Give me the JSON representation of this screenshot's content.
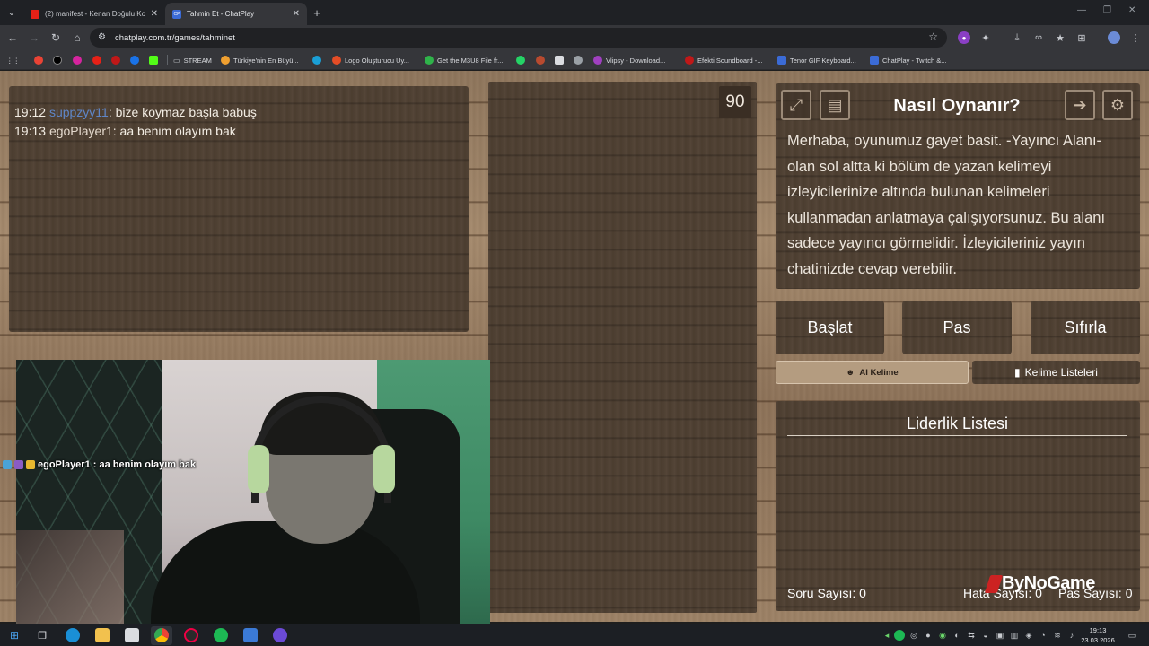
{
  "browser": {
    "tabs": [
      {
        "label": "(2) manifest - Kenan Doğulu Ko",
        "favicon_color": "#e62117"
      },
      {
        "label": "Tahmin Et - ChatPlay",
        "favicon_color": "#3b6bd6",
        "favicon_text": "CP"
      }
    ],
    "url": "chatplay.com.tr/games/tahminet",
    "bookmarks": [
      {
        "label": "STREAM",
        "color": "#c8cbd0"
      },
      {
        "label": "Türkiye'nin En Büyü...",
        "color": "#f0a030"
      },
      {
        "label": "Logo Oluşturucu Uy...",
        "color": "#e44d26"
      },
      {
        "label": "Get the M3U8 File fr...",
        "color": "#2fb34a"
      },
      {
        "label": "Vlipsy - Download...",
        "color": "#a040c0"
      },
      {
        "label": "Efekti Soundboard -...",
        "color": "#c01818"
      },
      {
        "label": "Tenor GIF Keyboard...",
        "color": "#3b6bd6"
      },
      {
        "label": "ChatPlay - Twitch &...",
        "color": "#3b6bd6"
      }
    ]
  },
  "chat": {
    "messages": [
      {
        "time": "19:12",
        "user": "suppzyy11",
        "text": ": bize koymaz başla babuş"
      },
      {
        "time": "19:13",
        "user": "egoPlayer1",
        "text": ": aa benim olayım bak"
      }
    ]
  },
  "game": {
    "timer": "90",
    "help_title": "Nasıl Oynanır?",
    "help_text": "Merhaba, oyunumuz gayet basit. -Yayıncı Alanı- olan sol altta ki bölüm de yazan kelimeyi izleyicilerinize altında bulunan kelimeleri kullanmadan anlatmaya çalışıyorsunuz. Bu alanı sadece yayıncı görmelidir. İzleyicileriniz yayın chatinizde cevap verebilir.",
    "buttons": {
      "start": "Başlat",
      "pass": "Pas",
      "reset": "Sıfırla",
      "ai_word": "AI Kelime",
      "word_lists": "Kelime Listeleri"
    },
    "leaderboard_title": "Liderlik Listesi",
    "stats": {
      "questions": "Soru Sayısı: 0",
      "errors": "Hata Sayısı: 0",
      "passes": "Pas Sayısı: 0"
    },
    "brand": "ByNoGame"
  },
  "webcam": {
    "overlay_text": "egoPlayer1 : aa benim olayım bak"
  },
  "taskbar": {
    "time": "19:13",
    "date": "23.03.2026"
  },
  "colors": {
    "wood_panel": "#4f4032",
    "chat_user_highlight": "#5f86c7",
    "ai_button": "#b49c80"
  }
}
